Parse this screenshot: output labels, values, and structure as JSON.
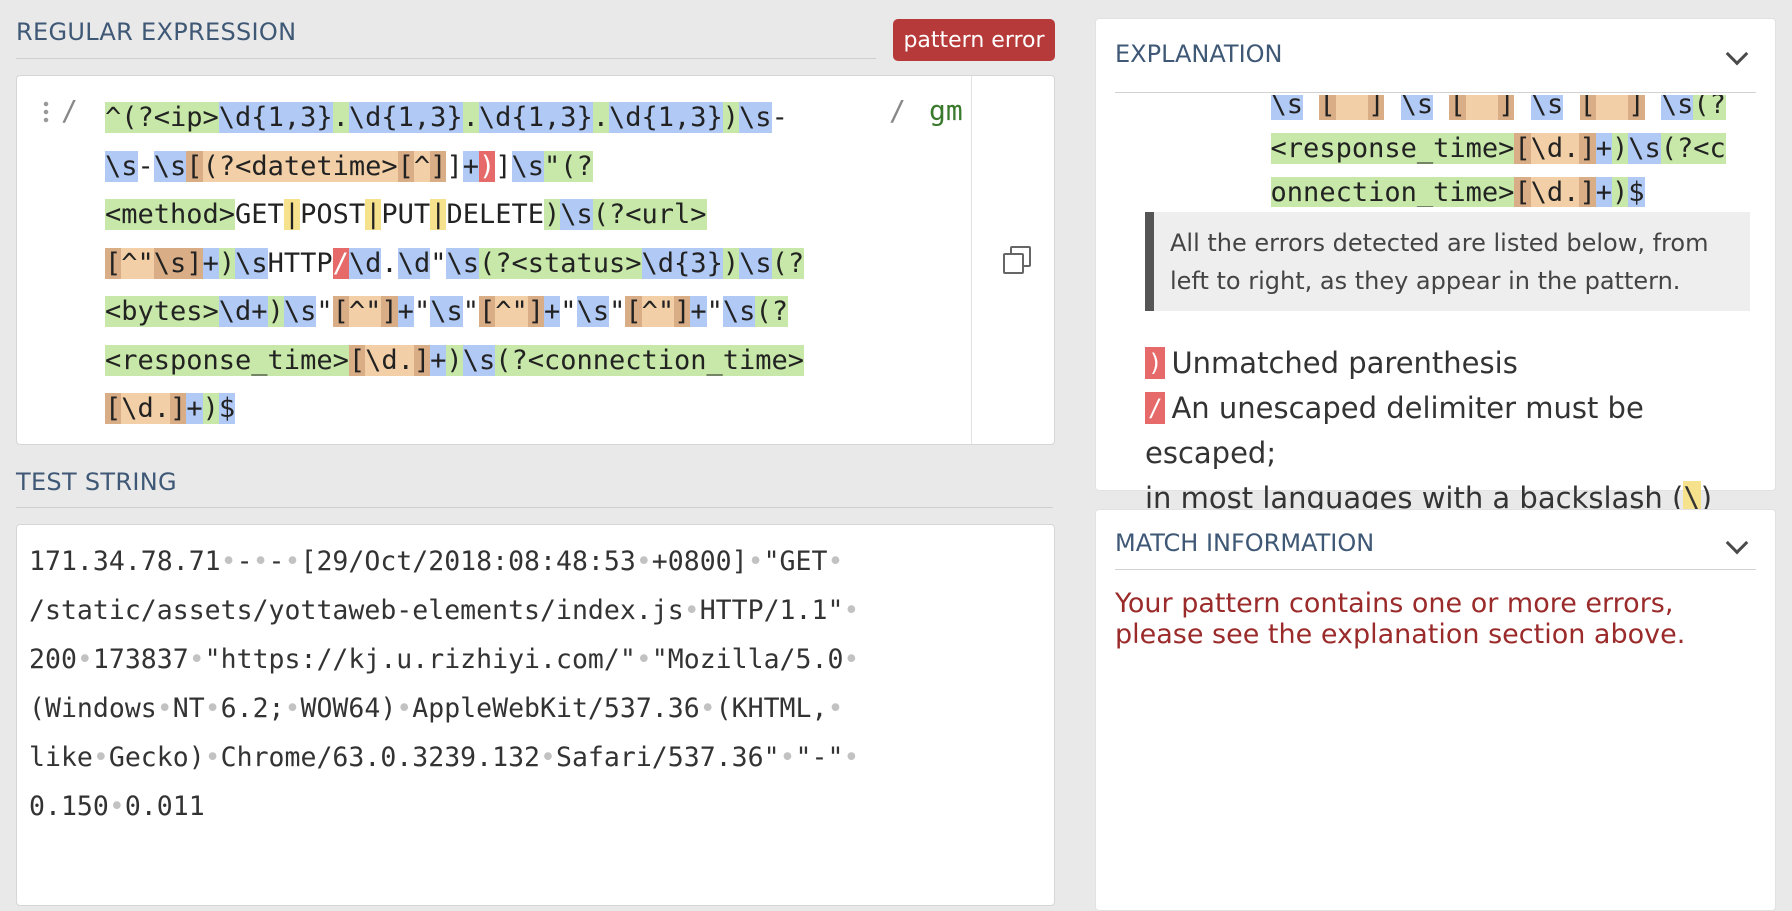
{
  "regex_section": {
    "title": "REGULAR EXPRESSION",
    "badge": "pattern error",
    "open_delimiter": "/",
    "close_delimiter": "/",
    "flags": "gm",
    "lines": [
      [
        [
          "g",
          "^(?<ip>"
        ],
        [
          "b",
          "\\d{1,3}"
        ],
        [
          "g",
          "."
        ],
        [
          "b",
          "\\d{1,3}"
        ],
        [
          "g",
          "."
        ],
        [
          "b",
          "\\d{1,3}"
        ],
        [
          "g",
          "."
        ],
        [
          "b",
          "\\d{1,3}"
        ],
        [
          "g",
          ")"
        ],
        [
          "b",
          "\\s"
        ],
        [
          "n",
          "-"
        ]
      ],
      [
        [
          "b",
          "\\s"
        ],
        [
          "n",
          "-"
        ],
        [
          "b",
          "\\s"
        ],
        [
          "cd",
          "["
        ],
        [
          "c",
          "(?<datetime>"
        ],
        [
          "cd",
          "["
        ],
        [
          "c",
          "^"
        ],
        [
          "cd",
          "]"
        ],
        [
          "n",
          "]"
        ],
        [
          "b",
          "+"
        ],
        [
          "r",
          ")"
        ],
        [
          "n",
          "]"
        ],
        [
          "b",
          "\\s"
        ],
        [
          "g",
          "\"(?"
        ]
      ],
      [
        [
          "g",
          "<method>"
        ],
        [
          "n",
          "GET"
        ],
        [
          "y",
          "|"
        ],
        [
          "n",
          "POST"
        ],
        [
          "y",
          "|"
        ],
        [
          "n",
          "PUT"
        ],
        [
          "y",
          "|"
        ],
        [
          "n",
          "DELETE"
        ],
        [
          "g",
          ")"
        ],
        [
          "b",
          "\\s"
        ],
        [
          "g",
          "(?<url>"
        ]
      ],
      [
        [
          "cd",
          "["
        ],
        [
          "c",
          "^\""
        ],
        [
          "cd",
          "\\s"
        ],
        [
          "cd",
          "]"
        ],
        [
          "b",
          "+"
        ],
        [
          "g",
          ")"
        ],
        [
          "b",
          "\\s"
        ],
        [
          "n",
          "HTTP"
        ],
        [
          "r",
          "/"
        ],
        [
          "b",
          "\\d"
        ],
        [
          "n",
          "."
        ],
        [
          "b",
          "\\d"
        ],
        [
          "n",
          "\""
        ],
        [
          "b",
          "\\s"
        ],
        [
          "g",
          "(?<status>"
        ],
        [
          "b",
          "\\d{3}"
        ],
        [
          "g",
          ")"
        ],
        [
          "b",
          "\\s"
        ],
        [
          "g",
          "(?"
        ]
      ],
      [
        [
          "g",
          "<bytes>"
        ],
        [
          "b",
          "\\d+"
        ],
        [
          "g",
          ")"
        ],
        [
          "b",
          "\\s"
        ],
        [
          "n",
          "\""
        ],
        [
          "cd",
          "["
        ],
        [
          "c",
          "^\""
        ],
        [
          "cd",
          "]"
        ],
        [
          "b",
          "+"
        ],
        [
          "n",
          "\""
        ],
        [
          "b",
          "\\s"
        ],
        [
          "n",
          "\""
        ],
        [
          "cd",
          "["
        ],
        [
          "c",
          "^\""
        ],
        [
          "cd",
          "]"
        ],
        [
          "b",
          "+"
        ],
        [
          "n",
          "\""
        ],
        [
          "b",
          "\\s"
        ],
        [
          "n",
          "\""
        ],
        [
          "cd",
          "["
        ],
        [
          "c",
          "^\""
        ],
        [
          "cd",
          "]"
        ],
        [
          "b",
          "+"
        ],
        [
          "n",
          "\""
        ],
        [
          "b",
          "\\s"
        ],
        [
          "g",
          "(?"
        ]
      ],
      [
        [
          "g",
          "<response_time>"
        ],
        [
          "cd",
          "["
        ],
        [
          "c",
          "\\d."
        ],
        [
          "cd",
          "]"
        ],
        [
          "b",
          "+"
        ],
        [
          "g",
          ")"
        ],
        [
          "b",
          "\\s"
        ],
        [
          "g",
          "(?<connection_time>"
        ]
      ],
      [
        [
          "cd",
          "["
        ],
        [
          "c",
          "\\d."
        ],
        [
          "cd",
          "]"
        ],
        [
          "b",
          "+"
        ],
        [
          "g",
          ")"
        ],
        [
          "b",
          "$"
        ]
      ]
    ]
  },
  "test_section": {
    "title": "TEST STRING",
    "lines": [
      "171.34.78.71 - - [29/Oct/2018:08:48:53 +0800] \"GET ",
      "/static/assets/yottaweb-elements/index.js HTTP/1.1\" ",
      "200 173837 \"https://kj.u.rizhiyi.com/\" \"Mozilla/5.0 ",
      "(Windows NT 6.2; WOW64) AppleWebKit/537.36 (KHTML, ",
      "like Gecko) Chrome/63.0.3239.132 Safari/537.36\" \"-\" ",
      "0.150 0.011"
    ]
  },
  "explanation": {
    "title": "EXPLANATION",
    "code_lines": [
      [
        [
          "pad",
          "      "
        ],
        [
          "b",
          "\\s"
        ],
        [
          "n",
          " "
        ],
        [
          "cd",
          "["
        ],
        [
          "c",
          "  "
        ],
        [
          "cd",
          "]"
        ],
        [
          "n",
          " "
        ],
        [
          "b",
          "\\s"
        ],
        [
          "n",
          " "
        ],
        [
          "cd",
          "["
        ],
        [
          "c",
          "  "
        ],
        [
          "cd",
          "]"
        ],
        [
          "n",
          " "
        ],
        [
          "b",
          "\\s"
        ],
        [
          "n",
          " "
        ],
        [
          "cd",
          "["
        ],
        [
          "c",
          "  "
        ],
        [
          "cd",
          "]"
        ],
        [
          "n",
          " "
        ],
        [
          "b",
          "\\s"
        ],
        [
          "g",
          "(?"
        ]
      ],
      [
        [
          "pad",
          "      "
        ],
        [
          "g",
          "<response_time>"
        ],
        [
          "cd",
          "["
        ],
        [
          "c",
          "\\d."
        ],
        [
          "cd",
          "]"
        ],
        [
          "b",
          "+"
        ],
        [
          "g",
          ")"
        ],
        [
          "b",
          "\\s"
        ],
        [
          "g",
          "(?<c"
        ]
      ],
      [
        [
          "pad",
          "      "
        ],
        [
          "g",
          "onnection_time>"
        ],
        [
          "cd",
          "["
        ],
        [
          "c",
          "\\d."
        ],
        [
          "cd",
          "]"
        ],
        [
          "b",
          "+"
        ],
        [
          "g",
          ")"
        ],
        [
          "b",
          "$"
        ]
      ]
    ],
    "note": "All the errors detected are listed below, from left to right, as they appear in the pattern.",
    "errors": [
      {
        "mark": ")",
        "text": "Unmatched parenthesis"
      },
      {
        "mark": "/",
        "text": "An unescaped delimiter must be escaped;",
        "continuation": "in most languages with a backslash (",
        "code": "\\",
        "tail": ")"
      }
    ]
  },
  "match_info": {
    "title": "MATCH INFORMATION",
    "message_line1": "Your pattern contains one or more errors,",
    "message_line2": "please see the explanation section above."
  }
}
